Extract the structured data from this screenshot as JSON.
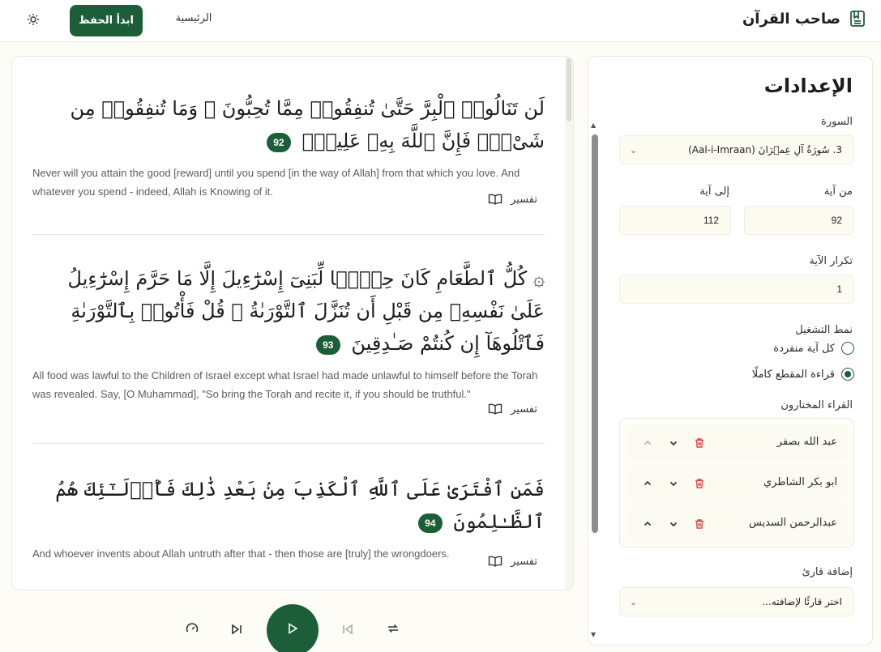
{
  "header": {
    "brand_title": "صاحب القرآن",
    "home_label": "الرئيسية",
    "start_label": "ابدأ الحفظ",
    "theme_icon": "sun-icon",
    "brand_icon": "book-bookmark-icon"
  },
  "verses": [
    {
      "arabic": "لَن تَنَالُوا۟ ٱلْبِرَّ حَتَّىٰ تُنفِقُوا۟ مِمَّا تُحِبُّونَ ۚ وَمَا تُنفِقُوا۟ مِن شَىْءٍۢ فَإِنَّ ٱللَّهَ بِهِۦ عَلِيمٌۭ",
      "number": "92",
      "translation": "Never will you attain the good [reward] until you spend [in the way of Allah] from that which you love. And whatever you spend - indeed, Allah is Knowing of it.",
      "tafsir_label": "تفسير"
    },
    {
      "arabic": "۞ كُلُّ ٱلطَّعَامِ كَانَ حِلًّۭا لِّبَنِىٓ إِسْرَٰٓءِيلَ إِلَّا مَا حَرَّمَ إِسْرَٰٓءِيلُ عَلَىٰ نَفْسِهِۦ مِن قَبْلِ أَن تُنَزَّلَ ٱلتَّوْرَىٰةُ ۗ قُلْ فَأْتُوا۟ بِٱلتَّوْرَىٰةِ فَٱتْلُوهَآ إِن كُنتُمْ صَـٰدِقِينَ",
      "number": "93",
      "translation": "All food was lawful to the Children of Israel except what Israel had made unlawful to himself before the Torah was revealed. Say, [O Muhammad], \"So bring the Torah and recite it, if you should be truthful.\"",
      "tafsir_label": "تفسير"
    },
    {
      "arabic": "فَمَنِ ٱفْتَرَىٰ عَلَى ٱللَّهِ ٱلْكَذِبَ مِنۢ بَعْدِ ذَٰلِكَ فَأُو۟لَـٰٓئِكَ هُمُ ٱلظَّـٰلِمُونَ",
      "number": "94",
      "translation": "And whoever invents about Allah untruth after that - then those are [truly] the wrongdoers.",
      "tafsir_label": "تفسير"
    }
  ],
  "player": {
    "speed_icon": "gauge-icon",
    "next_icon": "skip-next-icon",
    "play_icon": "play-icon",
    "prev_icon": "skip-previous-icon",
    "repeat_icon": "repeat-icon"
  },
  "settings": {
    "title": "الإعدادات",
    "surah_label": "السورة",
    "surah_value": "3. سُورَةُ آلِ عِمۡرَانَ (Aal-i-Imraan)",
    "from_label": "من آية",
    "from_value": "92",
    "to_label": "إلى آية",
    "to_value": "112",
    "repeat_label": "تكرار الآية",
    "repeat_value": "1",
    "mode_label": "نمط التشغيل",
    "mode_options": [
      {
        "label": "كل آية منفردة",
        "selected": false
      },
      {
        "label": "قراءة المقطع كاملًا",
        "selected": true
      }
    ],
    "reciters_label": "القراء المختارون",
    "reciters": [
      {
        "name": "عبد الله بصفر",
        "up_enabled": false
      },
      {
        "name": "ابو بكر الشاطري",
        "up_enabled": true
      },
      {
        "name": "عبدالرحمن السديس",
        "up_enabled": true
      }
    ],
    "add_reciter_label": "إضافة قارئ",
    "add_reciter_placeholder": "اختر قارئًا لإضافته..."
  },
  "colors": {
    "primary": "#1b5e38",
    "delete": "#e0474c",
    "background": "#fdfcf6",
    "input_bg": "#fcfbf1"
  }
}
